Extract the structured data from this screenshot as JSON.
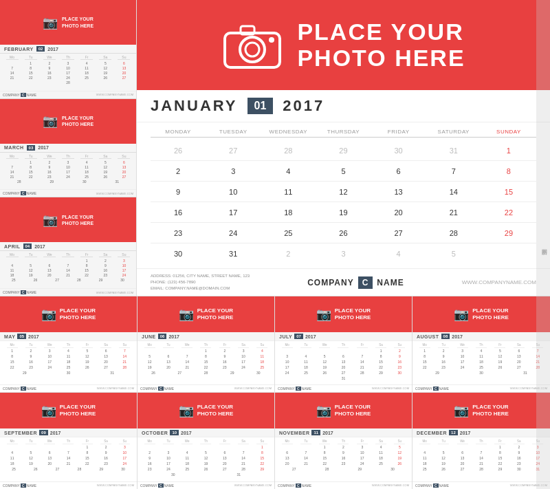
{
  "sidebar": {
    "months": [
      {
        "name": "FEBRUARY",
        "num": "02",
        "year": "2017",
        "weeks": [
          [
            "",
            "1",
            "2",
            "3",
            "4",
            "5",
            "6"
          ],
          [
            "7",
            "8",
            "9",
            "10",
            "11",
            "12",
            "13"
          ],
          [
            "14",
            "15",
            "16",
            "17",
            "18",
            "19",
            "20"
          ],
          [
            "21",
            "22",
            "23",
            "24",
            "25",
            "26",
            "27"
          ],
          [
            "28",
            "",
            "",
            "",
            "",
            "",
            ""
          ]
        ]
      },
      {
        "name": "MARCH",
        "num": "03",
        "year": "2017",
        "weeks": [
          [
            "",
            "1",
            "2",
            "3",
            "4",
            "5",
            "6"
          ],
          [
            "7",
            "8",
            "9",
            "10",
            "11",
            "12",
            "13"
          ],
          [
            "14",
            "15",
            "16",
            "17",
            "18",
            "19",
            "20"
          ],
          [
            "21",
            "22",
            "23",
            "24",
            "25",
            "26",
            "27"
          ],
          [
            "28",
            "29",
            "30",
            "31",
            "",
            "",
            ""
          ]
        ]
      },
      {
        "name": "APRIL",
        "num": "04",
        "year": "2017",
        "weeks": [
          [
            "",
            "",
            "",
            "",
            "1",
            "2",
            "3"
          ],
          [
            "4",
            "5",
            "6",
            "7",
            "8",
            "9",
            "10"
          ],
          [
            "11",
            "12",
            "13",
            "14",
            "15",
            "16",
            "17"
          ],
          [
            "18",
            "19",
            "20",
            "21",
            "22",
            "23",
            "24"
          ],
          [
            "25",
            "26",
            "27",
            "28",
            "29",
            "30",
            ""
          ]
        ]
      }
    ]
  },
  "main": {
    "photo_text_line1": "PLACE YOUR",
    "photo_text_line2": "PHOTO HERE",
    "month_name": "JANUARY",
    "month_num": "01",
    "year": "2017",
    "days_header": [
      "MONDAY",
      "TUESDAY",
      "WEDNESDAY",
      "THURSDAY",
      "FRIDAY",
      "SATURDAY",
      "SUNDAY"
    ],
    "weeks": [
      [
        "26",
        "27",
        "28",
        "29",
        "30",
        "31",
        "1"
      ],
      [
        "2",
        "3",
        "4",
        "5",
        "6",
        "7",
        "8"
      ],
      [
        "9",
        "10",
        "11",
        "12",
        "13",
        "14",
        "15"
      ],
      [
        "16",
        "17",
        "18",
        "19",
        "20",
        "21",
        "22"
      ],
      [
        "23",
        "24",
        "25",
        "26",
        "27",
        "28",
        "29"
      ],
      [
        "30",
        "31",
        "2",
        "3",
        "4",
        "5",
        ""
      ]
    ],
    "sunday_dates": [
      "1",
      "8",
      "15",
      "22",
      "29"
    ],
    "other_month_start": [
      "26",
      "27",
      "28",
      "29",
      "30",
      "31"
    ],
    "other_month_end": [
      "2",
      "3",
      "4",
      "5"
    ],
    "address": "ADDRESS: 01256, CITY NAME, STREET NAME, 123\nPHONE: (123) 456-7890\nEMAIL: COMPANY.NAME@DOMAIN.COM",
    "company_name": "COMPANY",
    "company_c": "C",
    "company_name2": "NAME",
    "website": "WWW.COMPANYNAME.COM"
  },
  "small_months": [
    {
      "name": "MAY",
      "num": "05",
      "year": "2017"
    },
    {
      "name": "JUNE",
      "num": "06",
      "year": "2017"
    },
    {
      "name": "JULY",
      "num": "07",
      "year": "2017"
    },
    {
      "name": "AUGUST",
      "num": "08",
      "year": "2017"
    },
    {
      "name": "SEPTEMBER",
      "num": "09",
      "year": "2017"
    },
    {
      "name": "OCTOBER",
      "num": "10",
      "year": "2017"
    },
    {
      "name": "NOVEMBER",
      "num": "11",
      "year": "2017"
    },
    {
      "name": "DECEMBER",
      "num": "12",
      "year": "2017"
    }
  ],
  "photo_placeholder": "PLACE YOUR\nPHOTO HERE",
  "company": {
    "label": "COMPANY",
    "c": "C",
    "name": "NAME",
    "url": "WWW.COMPANYNAME.COM"
  },
  "colors": {
    "red": "#e84040",
    "dark": "#3d5063"
  }
}
